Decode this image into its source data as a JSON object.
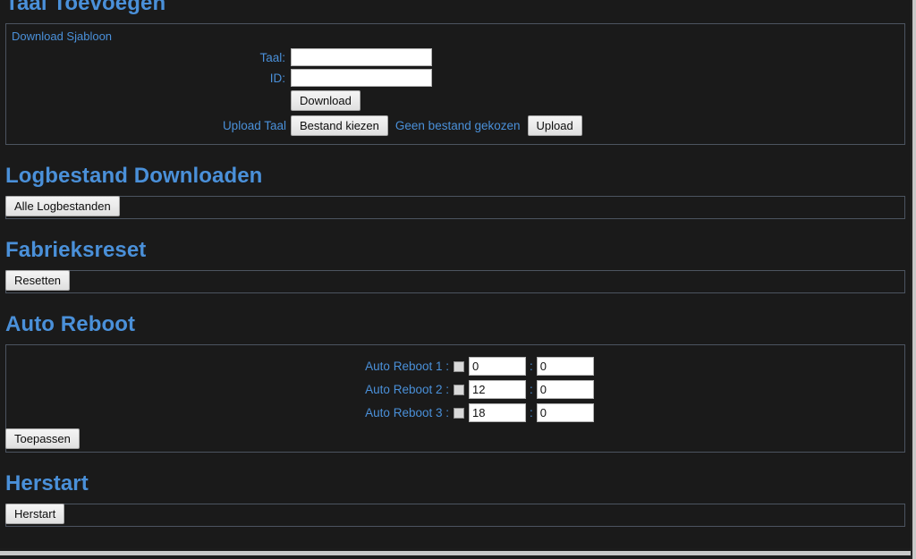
{
  "page": {
    "accent_color": "#4a90d9",
    "background_color": "#1a1a1a",
    "button_face_color": "#ececec"
  },
  "sections": {
    "add_language": {
      "heading": "Taal Toevoegen",
      "panel_legend": "Download Sjabloon",
      "fields": [
        {
          "label": "Taal:",
          "value": "",
          "placeholder": ""
        },
        {
          "label": "ID:",
          "value": "",
          "placeholder": ""
        }
      ],
      "download_button": "Download",
      "upload_label": "Upload Taal",
      "choose_file_button": "Bestand kiezen",
      "file_status": "Geen bestand gekozen",
      "upload_button": "Upload"
    },
    "download_log": {
      "heading": "Logbestand Downloaden",
      "button": "Alle Logbestanden"
    },
    "factory_reset": {
      "heading": "Fabrieksreset",
      "button": "Resetten"
    },
    "auto_reboot": {
      "heading": "Auto Reboot",
      "separator": ":",
      "rows": [
        {
          "label": "Auto Reboot 1 :",
          "enabled": false,
          "hour": "0",
          "minute": "0"
        },
        {
          "label": "Auto Reboot 2 :",
          "enabled": false,
          "hour": "12",
          "minute": "0"
        },
        {
          "label": "Auto Reboot 3 :",
          "enabled": false,
          "hour": "18",
          "minute": "0"
        }
      ],
      "apply_button": "Toepassen"
    },
    "restart": {
      "heading": "Herstart",
      "button": "Herstart"
    }
  }
}
